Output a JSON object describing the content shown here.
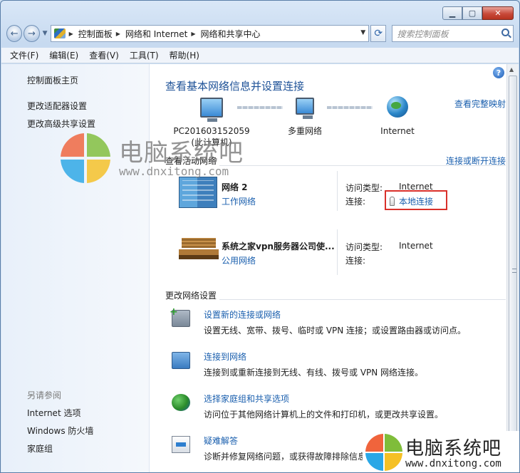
{
  "window": {
    "minimize": "▁",
    "maximize": "▢",
    "close": "✕"
  },
  "nav": {
    "back_icon": "←",
    "forward_icon": "→",
    "refresh_icon": "⟳",
    "crumbs": [
      "控制面板",
      "网络和 Internet",
      "网络和共享中心"
    ],
    "search_placeholder": "搜索控制面板"
  },
  "menu": [
    "文件(F)",
    "编辑(E)",
    "查看(V)",
    "工具(T)",
    "帮助(H)"
  ],
  "sidebar": {
    "items": [
      "控制面板主页",
      "更改适配器设置",
      "更改高级共享设置"
    ],
    "see_also_header": "另请参阅",
    "see_also": [
      "Internet 选项",
      "Windows 防火墙",
      "家庭组"
    ]
  },
  "main": {
    "help_icon": "?",
    "title": "查看基本网络信息并设置连接",
    "full_map": "查看完整映射",
    "map": {
      "pc_name": "PC201603152059",
      "pc_sub": "(此计算机)",
      "middle": "多重网络",
      "right": "Internet"
    },
    "active_header": "查看活动网络",
    "connect_disconnect": "连接或断开连接",
    "networks": [
      {
        "name": "网络  2",
        "type": "工作网络",
        "access_label": "访问类型:",
        "access_value": "Internet",
        "conn_label": "连接:",
        "conn_value": "本地连接"
      },
      {
        "name": "系统之家vpn服务器公司使...",
        "type": "公用网络",
        "access_label": "访问类型:",
        "access_value": "Internet",
        "conn_label": "连接:",
        "conn_value": ""
      }
    ],
    "change_header": "更改网络设置",
    "tasks": [
      {
        "title": "设置新的连接或网络",
        "desc": "设置无线、宽带、拨号、临时或 VPN 连接；或设置路由器或访问点。"
      },
      {
        "title": "连接到网络",
        "desc": "连接到或重新连接到无线、有线、拨号或 VPN 网络连接。"
      },
      {
        "title": "选择家庭组和共享选项",
        "desc": "访问位于其他网络计算机上的文件和打印机，或更改共享设置。"
      },
      {
        "title": "疑难解答",
        "desc": "诊断并修复网络问题，或获得故障排除信息。"
      }
    ]
  },
  "watermark": {
    "brand": "电脑系统吧",
    "url": "www.dnxitong.com"
  },
  "colors": {
    "link": "#1a5fae",
    "title": "#1d5197",
    "highlight": "#d9302a"
  }
}
